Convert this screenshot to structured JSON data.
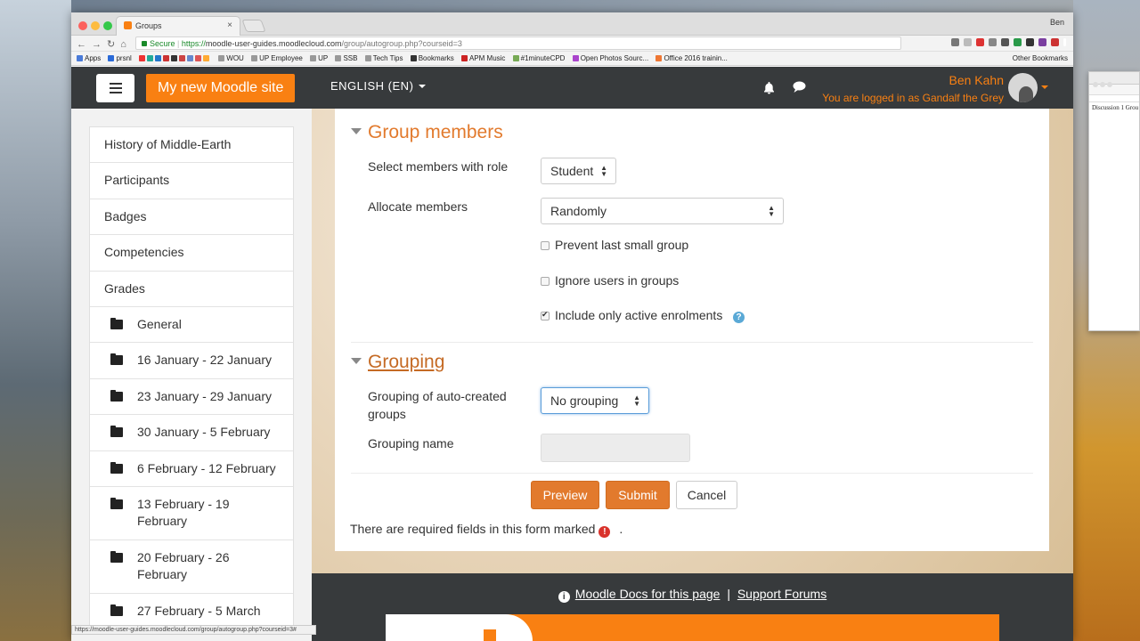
{
  "browser": {
    "tab_title": "Groups",
    "tab_close": "×",
    "profile": "Ben",
    "url_secure": "Secure",
    "url_scheme": "https://",
    "url_host": "moodle-user-guides.moodlecloud.com",
    "url_path": "/group/autogroup.php?courseid=3",
    "bookmarks": [
      "Apps",
      "prsnl",
      "WOU",
      "UP Employee",
      "UP",
      "SSB",
      "Tech Tips",
      "Bookmarks",
      "APM Music",
      "#1minuteCPD",
      "Open Photos Sourc...",
      "Office 2016 trainin..."
    ],
    "other_bookmarks": "Other Bookmarks",
    "status_url": "https://moodle-user-guides.moodlecloud.com/group/autogroup.php?courseid=3#"
  },
  "nav": {
    "site_name": "My new Moodle site",
    "language": "ENGLISH (EN)",
    "user_name": "Ben Kahn",
    "logged_in_as": "You are logged in as Gandalf the Grey"
  },
  "sidebar": {
    "items": [
      {
        "label": "History of Middle-Earth"
      },
      {
        "label": "Participants"
      },
      {
        "label": "Badges"
      },
      {
        "label": "Competencies"
      },
      {
        "label": "Grades"
      }
    ],
    "sections": [
      {
        "label": "General"
      },
      {
        "label": "16 January - 22 January"
      },
      {
        "label": "23 January - 29 January"
      },
      {
        "label": "30 January - 5 February"
      },
      {
        "label": "6 February - 12 February"
      },
      {
        "label": "13 February - 19 February"
      },
      {
        "label": "20 February - 26 February"
      },
      {
        "label": "27 February - 5 March"
      }
    ]
  },
  "form": {
    "group_members_heading": "Group members",
    "select_role_label": "Select members with role",
    "select_role_value": "Student",
    "allocate_label": "Allocate members",
    "allocate_value": "Randomly",
    "prevent_small_label": "Prevent last small group",
    "ignore_users_label": "Ignore users in groups",
    "include_active_label": "Include only active enrolments",
    "grouping_heading": "Grouping",
    "grouping_autocreated_label": "Grouping of auto-created groups",
    "grouping_value": "No grouping",
    "grouping_name_label": "Grouping name",
    "preview_button": "Preview",
    "submit_button": "Submit",
    "cancel_button": "Cancel",
    "required_text": "There are required fields in this form marked",
    "required_dot": "."
  },
  "footer": {
    "docs_link": "Moodle Docs for this page",
    "separator": "|",
    "forums_link": "Support Forums"
  },
  "mini_window": {
    "doc_text": "Discussion 1 Grou"
  },
  "colors": {
    "moodle_orange": "#f98012",
    "heading_orange": "#e27a2d",
    "navbar": "#373a3c"
  }
}
